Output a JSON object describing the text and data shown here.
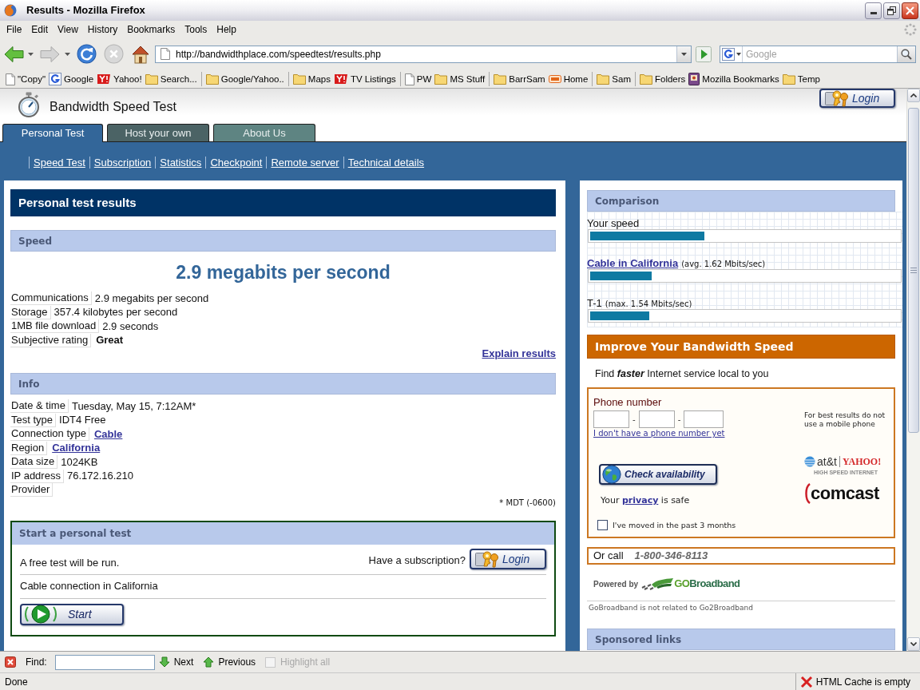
{
  "window": {
    "title": "Results - Mozilla Firefox"
  },
  "menu_bar": [
    "File",
    "Edit",
    "View",
    "History",
    "Bookmarks",
    "Tools",
    "Help"
  ],
  "navigation": {
    "url": "http://bandwidthplace.com/speedtest/results.php",
    "search": {
      "placeholder": "Google"
    }
  },
  "bookmarks": [
    {
      "kind": "page",
      "label": "\"Copy\""
    },
    {
      "kind": "google",
      "label": "Google"
    },
    {
      "kind": "yahoo",
      "label": "Yahoo!"
    },
    {
      "kind": "folder",
      "label": "Search..."
    },
    {
      "kind": "separator"
    },
    {
      "kind": "folder",
      "label": "Google/Yahoo.."
    },
    {
      "kind": "separator"
    },
    {
      "kind": "folder",
      "label": "Maps"
    },
    {
      "kind": "yahoo",
      "label": "TV Listings"
    },
    {
      "kind": "separator"
    },
    {
      "kind": "page",
      "label": "PW"
    },
    {
      "kind": "folder",
      "label": "MS Stuff"
    },
    {
      "kind": "separator"
    },
    {
      "kind": "folder",
      "label": "BarrSam"
    },
    {
      "kind": "barr",
      "label": "Home"
    },
    {
      "kind": "separator"
    },
    {
      "kind": "folder",
      "label": "Sam"
    },
    {
      "kind": "separator"
    },
    {
      "kind": "folder",
      "label": "Folders"
    },
    {
      "kind": "bookmarks",
      "label": "Mozilla Bookmarks"
    },
    {
      "kind": "folder",
      "label": "Temp"
    }
  ],
  "site": {
    "title": "Bandwidth Speed Test",
    "login_button": "Login"
  },
  "tabs": [
    {
      "label": "Personal Test",
      "selected": true,
      "color": "#336699"
    },
    {
      "label": "Host your own",
      "selected": false,
      "color": "#4b6365"
    },
    {
      "label": "About Us",
      "selected": false,
      "color": "#5e8482"
    }
  ],
  "nav_links": [
    "Speed Test",
    "Subscription",
    "Statistics",
    "Checkpoint",
    "Remote server",
    "Technical details"
  ],
  "results": {
    "title": "Personal test results",
    "speed": {
      "heading": "Speed",
      "headline": "2.9 megabits per second",
      "rows": [
        {
          "label": "Communications",
          "value": "2.9 megabits per second",
          "kind": "text"
        },
        {
          "label": "Storage",
          "value": "357.4 kilobytes per second",
          "kind": "text"
        },
        {
          "label": "1MB file download",
          "value": "2.9 seconds",
          "kind": "text"
        },
        {
          "label": "Subjective rating",
          "value": "Great",
          "kind": "strong"
        }
      ],
      "explain_link": "Explain results"
    },
    "info": {
      "heading": "Info",
      "rows": [
        {
          "label": "Date & time",
          "value": "Tuesday, May 15, 7:12AM*",
          "kind": "text"
        },
        {
          "label": "Test type",
          "value": "IDT4 Free",
          "kind": "text"
        },
        {
          "label": "Connection type",
          "value": "Cable",
          "kind": "link"
        },
        {
          "label": "Region",
          "value": "California",
          "kind": "link"
        },
        {
          "label": "Data size",
          "value": "1024KB",
          "kind": "text"
        },
        {
          "label": "IP address",
          "value": "76.172.16.210",
          "kind": "text"
        },
        {
          "label": "Provider",
          "kind": "text"
        }
      ],
      "footnote": "* MDT (-0600)"
    },
    "start_test": {
      "heading": "Start a personal test",
      "note": "A free test will be run.",
      "subscription_prompt": "Have a subscription?",
      "login_button": "Login",
      "connection": "Cable connection in California",
      "start_button": "Start"
    }
  },
  "comparison": {
    "heading": "Comparison",
    "bars": [
      {
        "label": "Your speed",
        "kind": "plain",
        "level": 0.37
      },
      {
        "label": "Cable in California",
        "kind": "link",
        "note": "(avg. 1.62 Mbits/sec)",
        "level": 0.2
      },
      {
        "label": "T-1",
        "kind": "plain",
        "note": "(max. 1.54 Mbits/sec)",
        "level": 0.19
      }
    ]
  },
  "improve": {
    "heading": "Improve Your Bandwidth Speed",
    "tagline": "Find *faster* Internet service local to you",
    "phone_label": "Phone number",
    "phone_separators": [
      "-",
      "-"
    ],
    "no_phone_link": "I don't have a phone number yet",
    "mobile_note": "For best results do not use a mobile phone",
    "check_button": "Check availability",
    "privacy": {
      "before": "Your",
      "link": "privacy",
      "after": "is safe"
    },
    "moved": {
      "label": "I've moved in the past 3 months",
      "checked": false
    },
    "partner_logos": {
      "att": "at&t",
      "yahoo": "YAHOO!",
      "caption": "HIGH SPEED INTERNET",
      "comcast": "comcast"
    },
    "call": {
      "label": "Or call",
      "phone": "1-800-346-8113"
    },
    "powered_by": {
      "label": "Powered by",
      "logo": [
        "GO",
        "Broadband"
      ]
    },
    "disclaimer": "GoBroadband is not related to Go2Broadband"
  },
  "sponsored": {
    "heading": "Sponsored links"
  },
  "find_bar": {
    "label": "Find:",
    "next": "Next",
    "previous": "Previous",
    "highlight_all": {
      "label": "Highlight all",
      "disabled": true
    }
  },
  "status_bar": {
    "text": "Done",
    "cache_status": "HTML Cache is empty"
  }
}
